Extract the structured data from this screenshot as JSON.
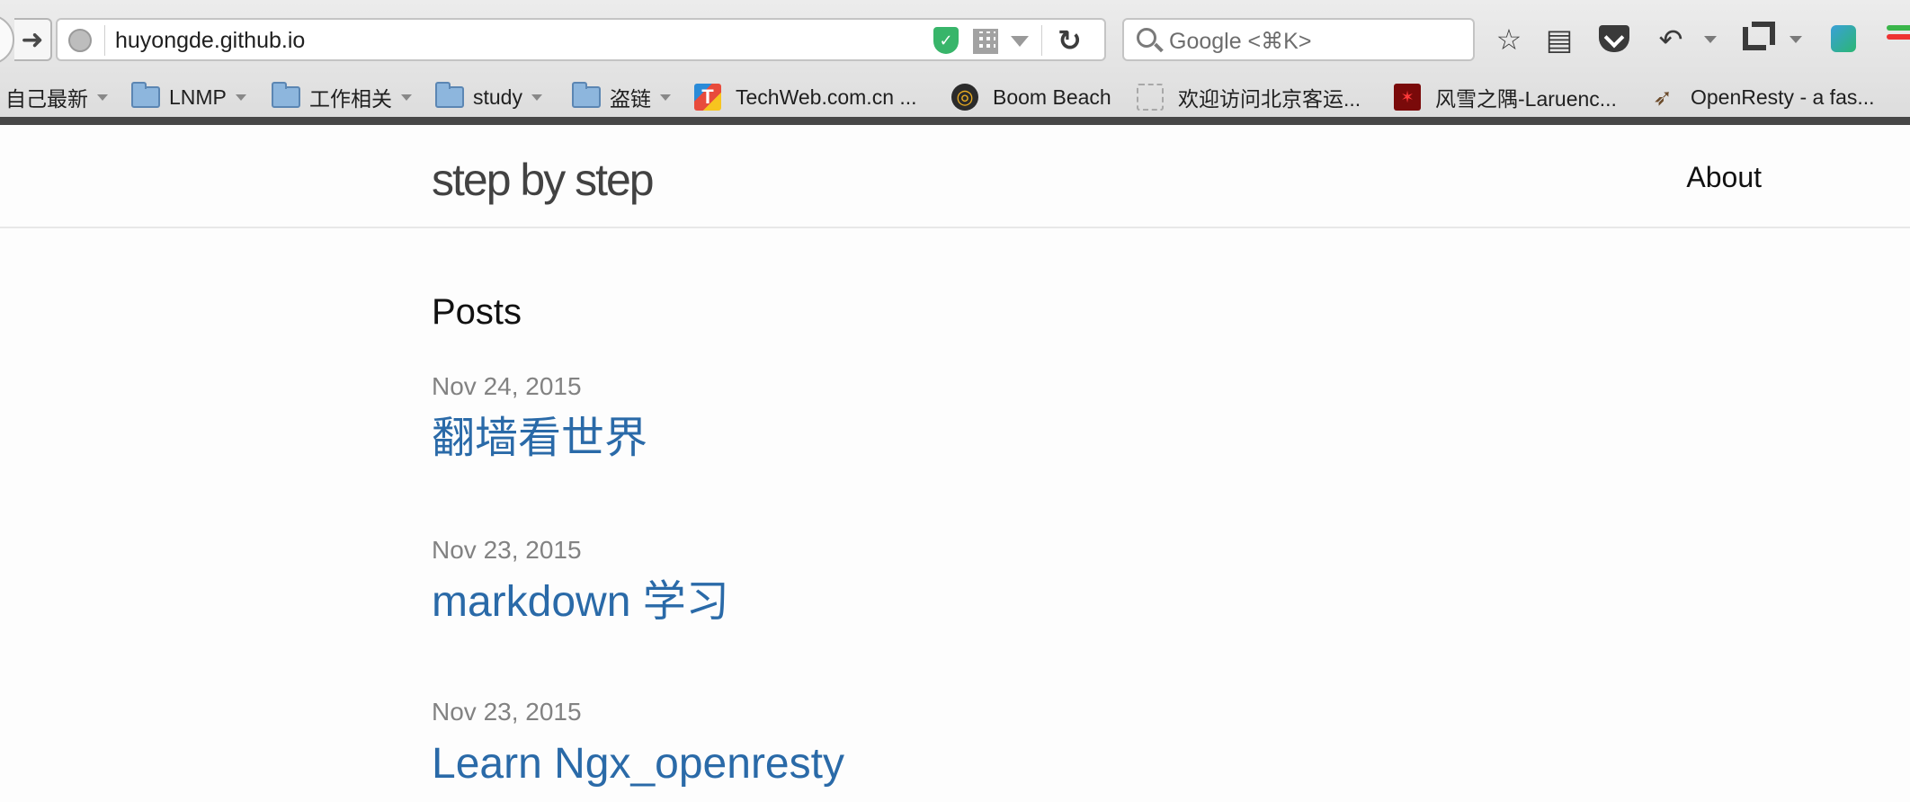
{
  "browser": {
    "url": "huyongde.github.io",
    "search_placeholder": "Google <⌘K>"
  },
  "bookmarks": [
    {
      "label": "自己最新",
      "type": "folder"
    },
    {
      "label": "LNMP",
      "type": "folder"
    },
    {
      "label": "工作相关",
      "type": "folder"
    },
    {
      "label": "study",
      "type": "folder"
    },
    {
      "label": "盗链",
      "type": "folder"
    },
    {
      "label": "TechWeb.com.cn ...",
      "type": "site"
    },
    {
      "label": "Boom Beach",
      "type": "site"
    },
    {
      "label": "欢迎访问北京客运...",
      "type": "site"
    },
    {
      "label": "风雪之隅-Laruenc...",
      "type": "site"
    },
    {
      "label": "OpenResty - a fas...",
      "type": "site"
    }
  ],
  "site": {
    "title": "step by step",
    "nav": {
      "about": "About"
    }
  },
  "main": {
    "heading": "Posts",
    "posts": [
      {
        "date": "Nov 24, 2015",
        "title": "翻墙看世界"
      },
      {
        "date": "Nov 23, 2015",
        "title": "markdown 学习"
      },
      {
        "date": "Nov 23, 2015",
        "title": "Learn Ngx_openresty"
      }
    ]
  },
  "colors": {
    "link": "#2a6aa8",
    "date": "#828282",
    "background": "#fdfdfd"
  }
}
